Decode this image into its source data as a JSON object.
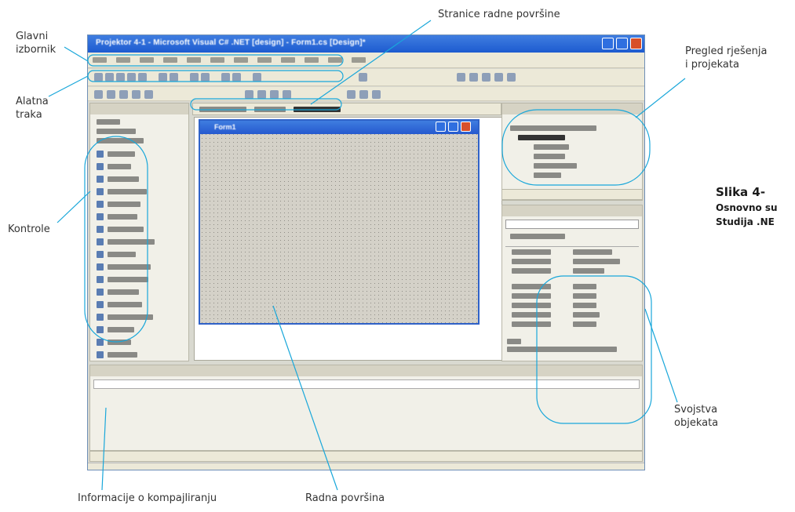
{
  "labels": {
    "main_menu": [
      "Glavni",
      "izbornik"
    ],
    "toolbar": [
      "Alatna",
      "traka"
    ],
    "controls": "Kontrole",
    "workspace_pages": "Stranice radne površine",
    "solution_overview": [
      "Pregled rješenja",
      "i projekata"
    ],
    "object_properties": [
      "Svojstva",
      "objekata"
    ],
    "compile_info": "Informacije o kompajliranju",
    "workspace": "Radna površina"
  },
  "caption": {
    "line1": "Slika 4-",
    "line2": "Osnovno su",
    "line3": "Studija .NE"
  },
  "colors": {
    "leader_line": "#19a7da",
    "title_bar": "#2a66d6",
    "ide_background": "#d9d9d0",
    "form_grid": "#d4d1c8"
  },
  "screenshot": {
    "title": "Projektor 4-1 - Microsoft Visual C# .NET [design] - Form1.cs [Design]*",
    "form_title": "Form1",
    "icons": [
      "minimize-icon",
      "maximize-icon",
      "close-icon"
    ]
  }
}
